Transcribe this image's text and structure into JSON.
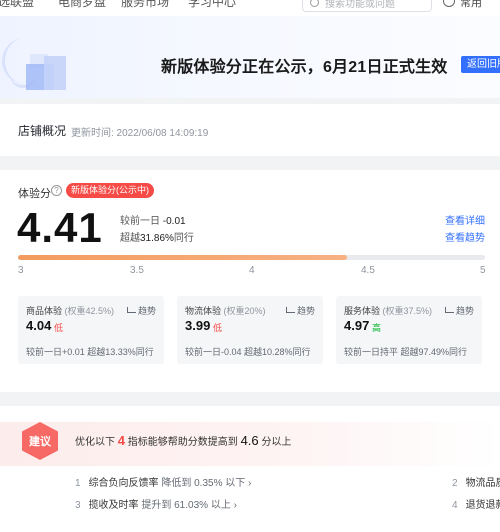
{
  "topnav": {
    "items": [
      "选联盟",
      "电商罗盘",
      "服务市场",
      "学习中心"
    ],
    "search_placeholder": "搜索功能或问题",
    "often": "常用"
  },
  "banner": {
    "headline": "新版体验分正在公示，6月21日正式生效",
    "back_button": "返回旧版"
  },
  "overview": {
    "title": "店铺概况",
    "updated": "更新时间: 2022/06/08 14:09:19"
  },
  "score": {
    "label": "体验分",
    "help": "?",
    "pill": "新版体验分(公示中)",
    "value": "4.41",
    "compare_label": "较前一日",
    "compare_value": "-0.01",
    "beat_label": "超越",
    "beat_value": "31.86%",
    "beat_suffix": "同行",
    "link_detail": "查看详细",
    "link_trend": "查看趋势",
    "progress_value": 4.41,
    "progress_min": 3,
    "progress_max": 5,
    "ticks": [
      "3",
      "3.5",
      "4",
      "4.5",
      "5"
    ],
    "colors": {
      "accent": "#3370ff",
      "danger": "#f54a45",
      "good": "#00b42a",
      "bar": "#f39b5e"
    }
  },
  "subs": [
    {
      "name": "商品体验",
      "weight": "(权重42.5%)",
      "trend": "趋势",
      "value": "4.04",
      "tag": "低",
      "foot": "较前一日+0.01   超越13.33%同行"
    },
    {
      "name": "物流体验",
      "weight": "(权重20%)",
      "trend": "趋势",
      "value": "3.99",
      "tag": "低",
      "foot": "较前一日-0.04   超越10.28%同行"
    },
    {
      "name": "服务体验",
      "weight": "(权重37.5%)",
      "trend": "趋势",
      "value": "4.97",
      "tag": "高",
      "foot": "较前一日持平   超越97.49%同行"
    }
  ],
  "advice": {
    "badge": "建议",
    "prefix": "优化以下",
    "count": "4",
    "middle": "指标能够帮助分数提高到",
    "target": "4.6",
    "suffix": "分以上",
    "items": [
      {
        "idx": "1",
        "label": "综合负向反馈率",
        "detail": "降低到 0.35% 以下 ›"
      },
      {
        "idx": "2",
        "label": "物流品质",
        "detail": ""
      },
      {
        "idx": "3",
        "label": "揽收及时率",
        "detail": "提升到 61.03% 以上 ›"
      },
      {
        "idx": "4",
        "label": "退货退款",
        "detail": ""
      }
    ]
  }
}
